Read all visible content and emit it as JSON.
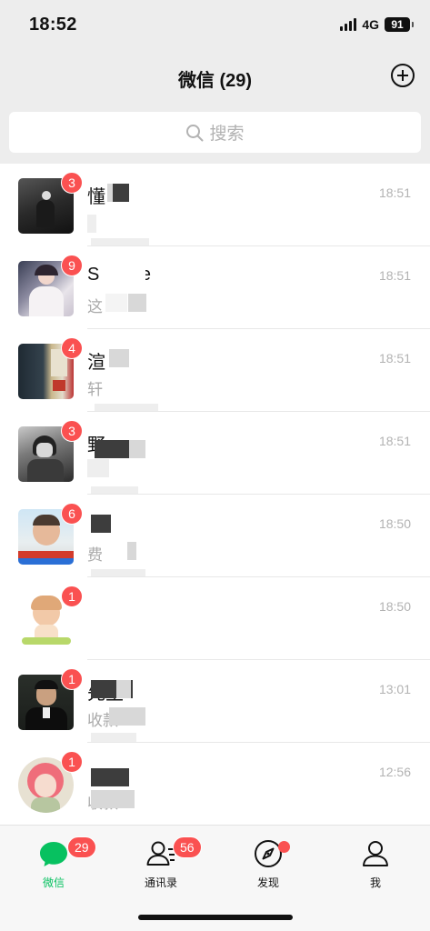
{
  "status_bar": {
    "time": "18:52",
    "network": "4G",
    "battery": "91"
  },
  "header": {
    "title": "微信 (29)"
  },
  "search": {
    "placeholder": "搜索"
  },
  "chats": [
    {
      "name": "懂",
      "time": "18:51",
      "preview": "",
      "unread": "3"
    },
    {
      "name": "S     White",
      "time": "18:51",
      "preview": "这",
      "unread": "9"
    },
    {
      "name": "渲",
      "time": "18:51",
      "preview": "轩",
      "unread": "4"
    },
    {
      "name": "野",
      "time": "18:51",
      "preview": "",
      "unread": "3"
    },
    {
      "name": "",
      "time": "18:50",
      "preview": "      费",
      "unread": "6"
    },
    {
      "name": "",
      "time": "18:50",
      "preview": "",
      "unread": "1"
    },
    {
      "name": "     先生",
      "time": "13:01",
      "preview": "     收款",
      "unread": "1"
    },
    {
      "name": "",
      "time": "12:56",
      "preview": "     收款",
      "unread": "1"
    }
  ],
  "tabs": [
    {
      "label": "微信",
      "icon": "chat-bubble-icon",
      "badge": "29",
      "active": true
    },
    {
      "label": "通讯录",
      "icon": "contacts-icon",
      "badge": "56",
      "active": false
    },
    {
      "label": "发现",
      "icon": "compass-icon",
      "badge": "",
      "active": false
    },
    {
      "label": "我",
      "icon": "person-icon",
      "badge": "",
      "active": false
    }
  ],
  "colors": {
    "accent": "#07c160",
    "badge": "#fa5151",
    "background": "#ededed"
  }
}
